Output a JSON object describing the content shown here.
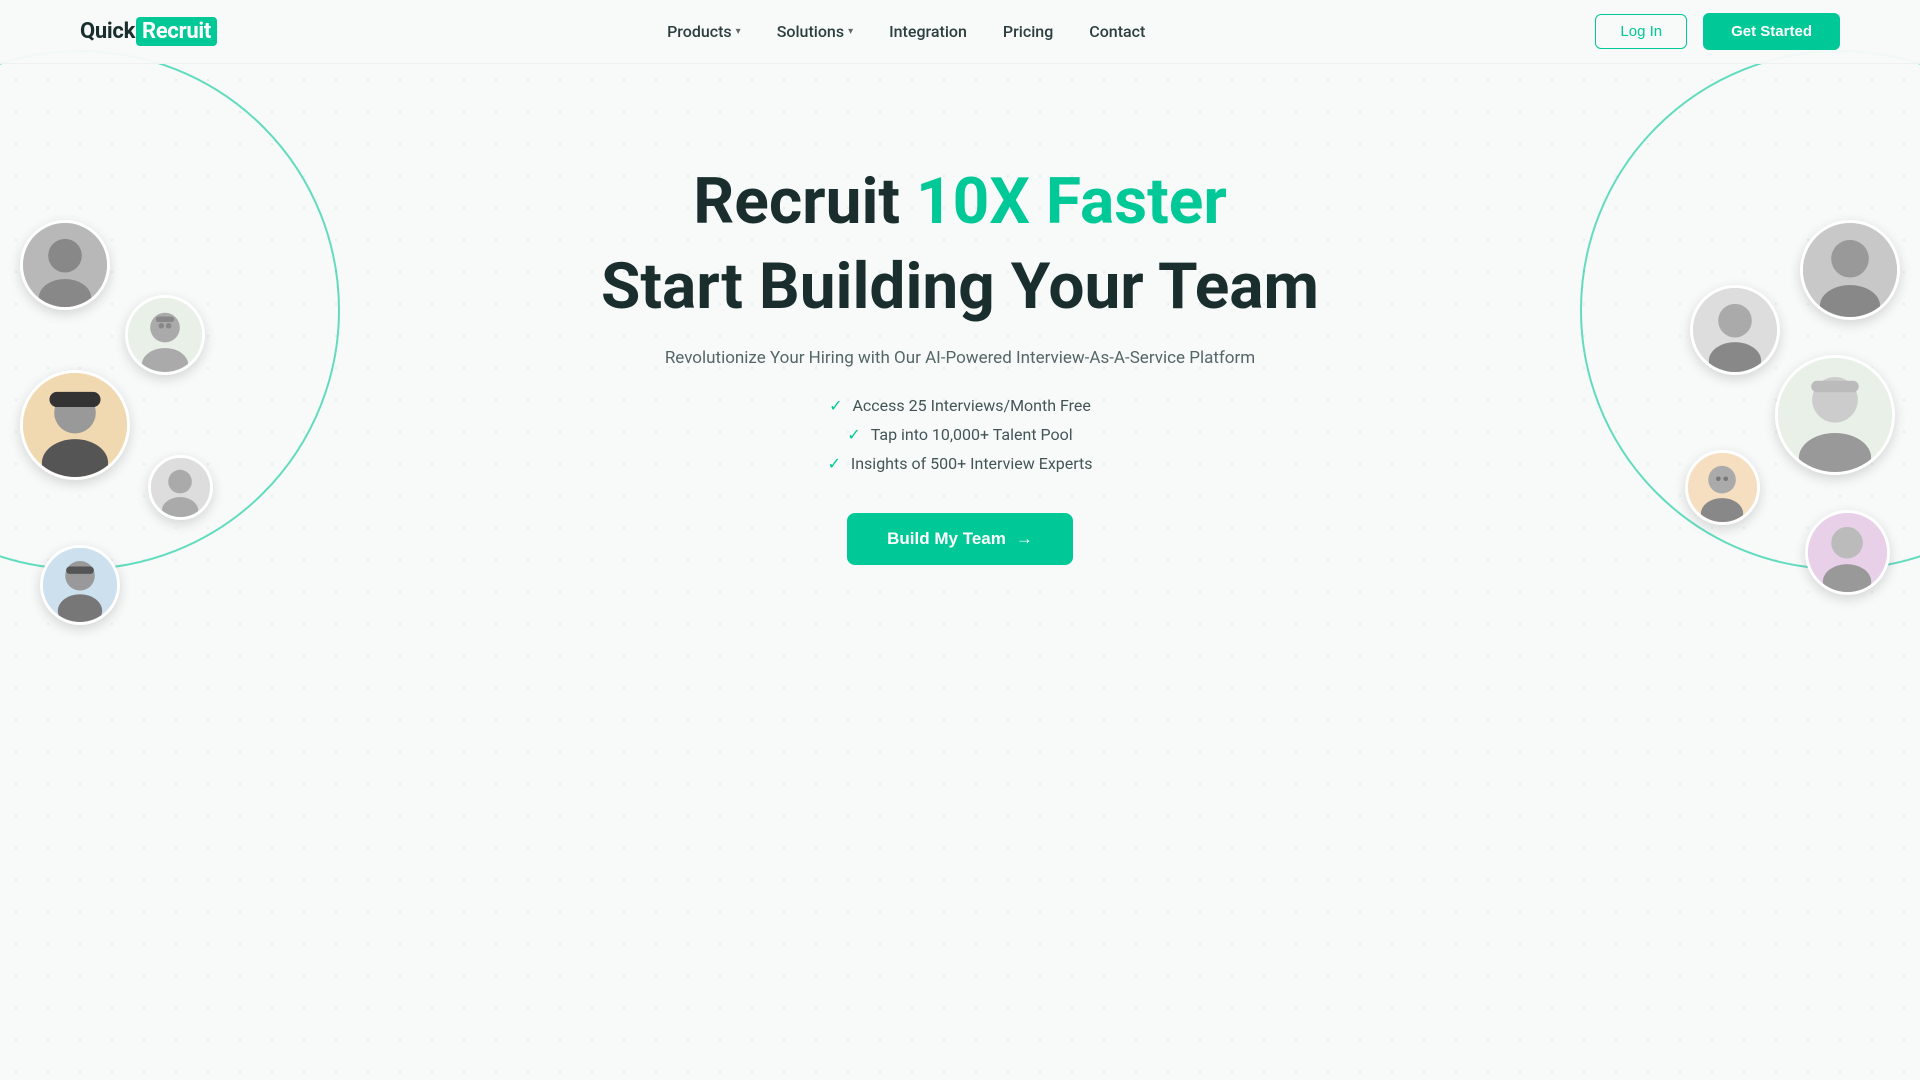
{
  "navbar": {
    "logo": {
      "prefix": "Quick",
      "highlight": "Recruit"
    },
    "nav_items": [
      {
        "label": "Products",
        "has_dropdown": true
      },
      {
        "label": "Solutions",
        "has_dropdown": true
      },
      {
        "label": "Integration",
        "has_dropdown": false
      },
      {
        "label": "Pricing",
        "has_dropdown": false
      },
      {
        "label": "Contact",
        "has_dropdown": false
      }
    ],
    "login_label": "Log In",
    "get_started_label": "Get Started"
  },
  "hero": {
    "title_prefix": "Recruit ",
    "title_highlight": "10X Faster",
    "title_line2": "Start Building Your Team",
    "description": "Revolutionize Your Hiring with Our AI-Powered Interview-As-A-Service Platform",
    "features": [
      "Access 25 Interviews/Month Free",
      "Tap into 10,000+ Talent Pool",
      "Insights of 500+ Interview Experts"
    ],
    "cta_label": "Build My Team",
    "cta_arrow": "→"
  },
  "colors": {
    "brand": "#00c896",
    "text_dark": "#1a2e2e",
    "text_muted": "#556666"
  }
}
